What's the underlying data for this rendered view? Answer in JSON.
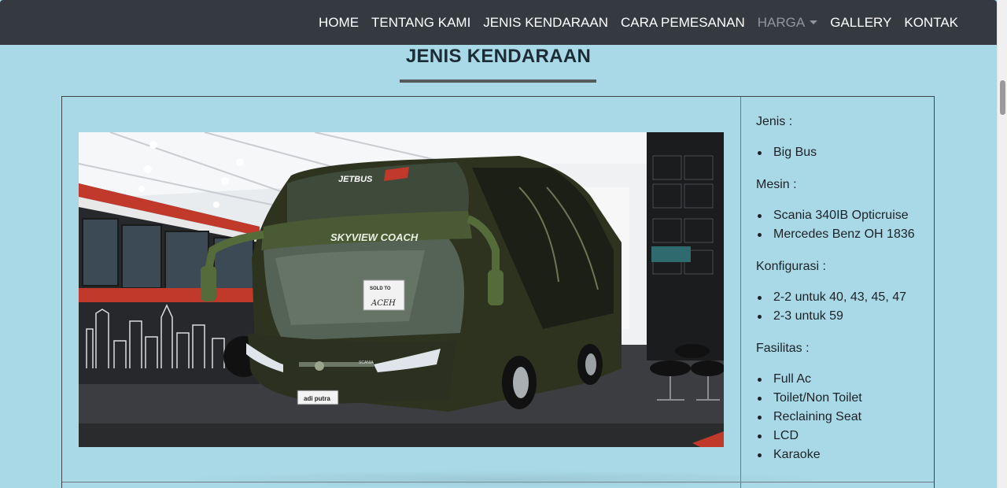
{
  "nav": {
    "items": [
      {
        "label": "HOME",
        "muted": false
      },
      {
        "label": "TENTANG KAMI",
        "muted": false
      },
      {
        "label": "JENIS KENDARAAN",
        "muted": false
      },
      {
        "label": "CARA PEMESANAN",
        "muted": false
      },
      {
        "label": "HARGA",
        "muted": true
      },
      {
        "label": "GALLERY",
        "muted": false
      },
      {
        "label": "KONTAK",
        "muted": false
      }
    ]
  },
  "section": {
    "title": "JENIS KENDARAAN"
  },
  "vehicle": {
    "photo_text": {
      "windshield_brand": "JETBUS",
      "model_badge": "SKYVIEW COACH",
      "dash_sign_line1": "SOLD TO",
      "dash_sign_line2": "ACEH",
      "grille_badge": "SCANIA",
      "plate": "adi putra"
    },
    "specs": [
      {
        "heading": "Jenis :",
        "items": [
          "Big Bus"
        ]
      },
      {
        "heading": "Mesin :",
        "items": [
          "Scania 340IB Opticruise",
          "Mercedes Benz OH 1836"
        ]
      },
      {
        "heading": "Konfigurasi :",
        "items": [
          "2-2 untuk 40, 43, 45, 47",
          "2-3 untuk 59"
        ]
      },
      {
        "heading": "Fasilitas :",
        "items": [
          "Full Ac",
          "Toilet/Non Toilet",
          "Reclaining Seat",
          "LCD",
          "Karaoke"
        ]
      }
    ]
  },
  "colors": {
    "navbar_bg": "#343a40",
    "page_bg": "#a9d9e6",
    "bus_body": "#2e3320",
    "left_bus_red": "#c0392b"
  }
}
